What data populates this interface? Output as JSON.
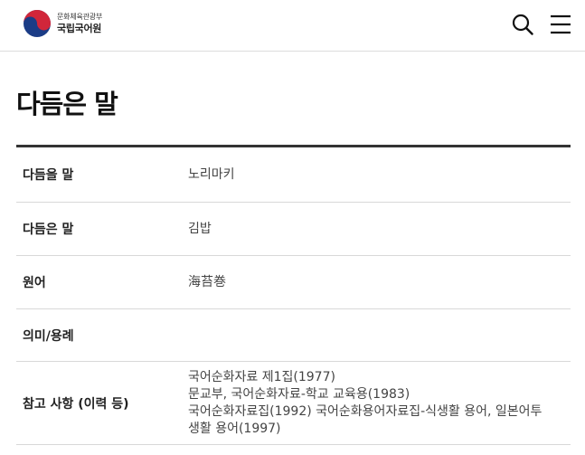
{
  "header": {
    "ministry": "문화체육관광부",
    "org_name": "국립국어원",
    "search_icon": "search-icon",
    "menu_icon": "hamburger-menu-icon"
  },
  "page": {
    "title": "다듬은 말"
  },
  "rows": [
    {
      "label": "다듬을 말",
      "value": "노리마키"
    },
    {
      "label": "다듬은 말",
      "value": "김밥"
    },
    {
      "label": "원어",
      "value": "海苔巻"
    },
    {
      "label": "의미/용례",
      "value": ""
    },
    {
      "label": "참고 사항 (이력 등)",
      "value_lines": [
        "국어순화자료 제1집(1977)",
        "문교부, 국어순화자료-학교 교육용(1983)",
        "국어순화자료집(1992) 국어순화용어자료집-식생활 용어, 일본어투",
        "생활 용어(1997)"
      ]
    }
  ],
  "colors": {
    "emblem_red": "#d1263a",
    "emblem_blue": "#1b3c86",
    "rule_dark": "#333333",
    "rule_light": "#d8d8d8"
  }
}
